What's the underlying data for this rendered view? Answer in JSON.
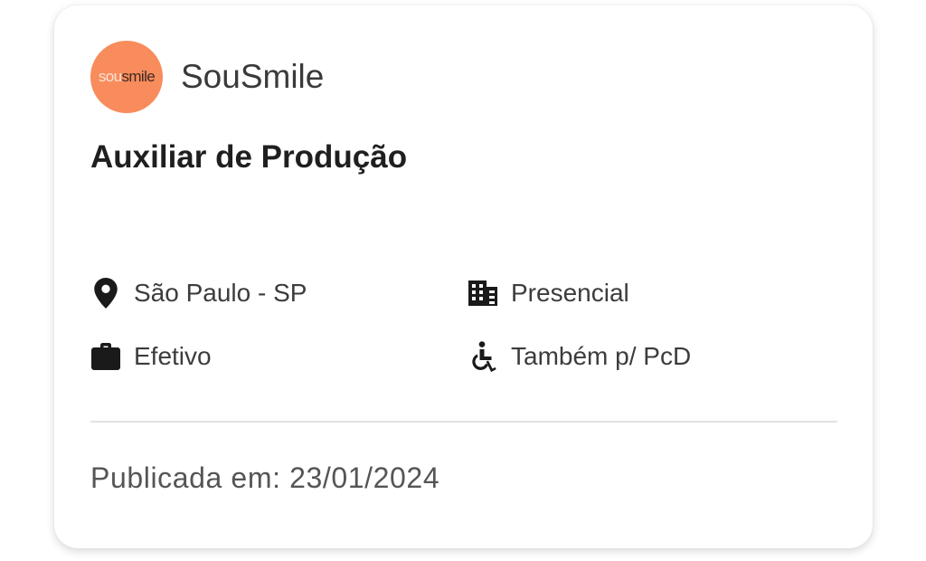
{
  "company": {
    "name": "SouSmile",
    "logo_text_a": "sou",
    "logo_text_b": "smile",
    "logo_color": "#f88c5c"
  },
  "job": {
    "title": "Auxiliar de Produção"
  },
  "attributes": {
    "location": {
      "icon": "location-pin-icon",
      "label": "São Paulo - SP"
    },
    "workplace": {
      "icon": "building-icon",
      "label": "Presencial"
    },
    "contract": {
      "icon": "briefcase-icon",
      "label": "Efetivo"
    },
    "pcd": {
      "icon": "accessibility-icon",
      "label": "Também p/ PcD"
    }
  },
  "footer": {
    "published_label": "Publicada em: 23/01/2024"
  }
}
